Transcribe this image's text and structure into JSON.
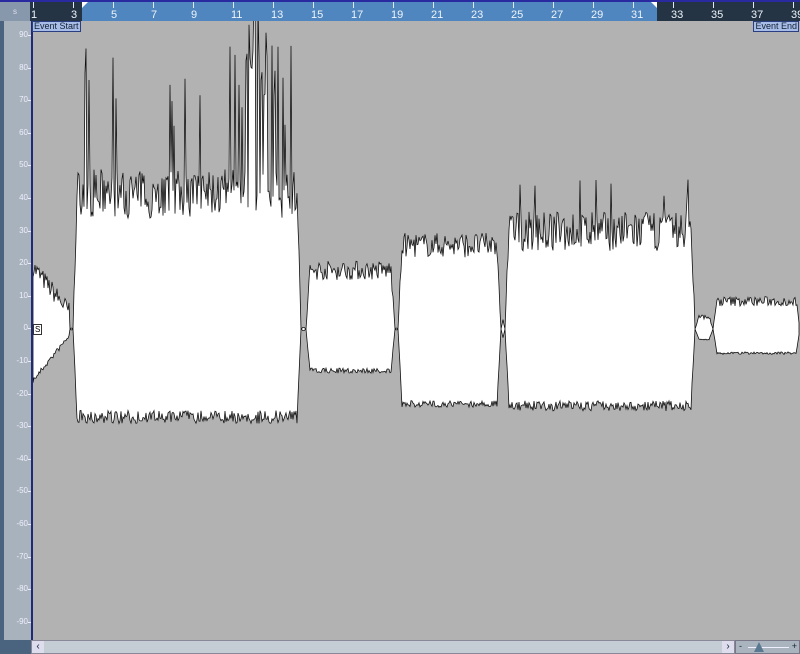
{
  "ruler": {
    "corner": "s",
    "bars": [
      "1",
      "3",
      "5",
      "7",
      "9",
      "11",
      "13",
      "15",
      "17",
      "19",
      "21",
      "23",
      "25",
      "27",
      "29",
      "31",
      "33",
      "35",
      "37",
      "39"
    ]
  },
  "events": {
    "start": "Event Start",
    "end": "Event End"
  },
  "level_scale": [
    "90",
    "80",
    "70",
    "60",
    "50",
    "40",
    "30",
    "20",
    "10",
    "0",
    "-10",
    "-20",
    "-30",
    "-40",
    "-50",
    "-60",
    "-70",
    "-80",
    "-90"
  ],
  "sync_marker": "S",
  "scrollbar": {
    "left": "‹",
    "right": "›"
  },
  "zoom": {
    "minus": "-",
    "plus": "+"
  }
}
